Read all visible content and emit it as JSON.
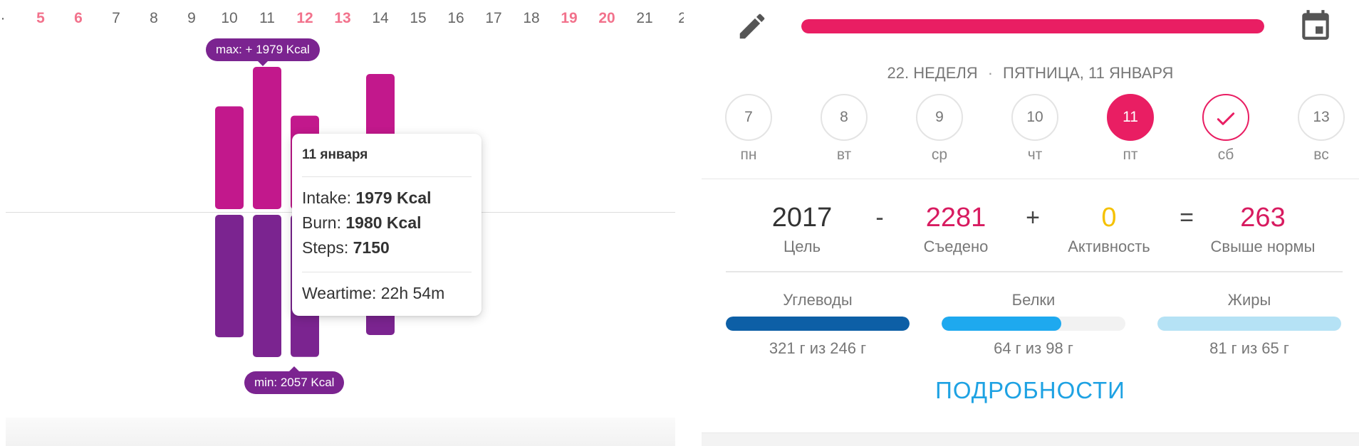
{
  "calendar_strip": {
    "days": [
      {
        "label": "·",
        "weekend": false
      },
      {
        "label": "5",
        "weekend": true
      },
      {
        "label": "6",
        "weekend": true
      },
      {
        "label": "7",
        "weekend": false
      },
      {
        "label": "8",
        "weekend": false
      },
      {
        "label": "9",
        "weekend": false
      },
      {
        "label": "10",
        "weekend": false
      },
      {
        "label": "11",
        "weekend": false
      },
      {
        "label": "12",
        "weekend": true
      },
      {
        "label": "13",
        "weekend": true
      },
      {
        "label": "14",
        "weekend": false
      },
      {
        "label": "15",
        "weekend": false
      },
      {
        "label": "16",
        "weekend": false
      },
      {
        "label": "17",
        "weekend": false
      },
      {
        "label": "18",
        "weekend": false
      },
      {
        "label": "19",
        "weekend": true
      },
      {
        "label": "20",
        "weekend": true
      },
      {
        "label": "21",
        "weekend": false
      },
      {
        "label": "2",
        "weekend": false
      }
    ]
  },
  "chart_data": {
    "type": "bar",
    "categories": [
      "10",
      "11",
      "12",
      "14"
    ],
    "series": [
      {
        "values": [
          1430,
          1979,
          1300,
          1880
        ]
      },
      {
        "values": [
          1770,
          2057,
          2055,
          1738
        ]
      }
    ],
    "max_label": "max: + 1979 Kcal",
    "min_label": "min: 2057 Kcal",
    "colors": {
      "intake": "#c2188c",
      "burn": "#7b2490"
    }
  },
  "tooltip": {
    "date": "11 января",
    "intake_label": "Intake: ",
    "intake_value": "1979 Kcal",
    "burn_label": "Burn: ",
    "burn_value": "1980 Kcal",
    "steps_label": "Steps: ",
    "steps_value": "7150",
    "weartime": "Weartime: 22h 54m"
  },
  "summary": {
    "edit_icon": "pencil-icon",
    "calendar_icon": "calendar-icon",
    "progress": 1.0,
    "progress_color": "#e91e63",
    "week_label": "22. НЕДЕЛЯ",
    "date_label": "ПЯТНИЦА, 11 ЯНВАРЯ",
    "separator": "·",
    "week_days": [
      {
        "num": "7",
        "label": "пн",
        "state": "normal"
      },
      {
        "num": "8",
        "label": "вт",
        "state": "normal"
      },
      {
        "num": "9",
        "label": "ср",
        "state": "normal"
      },
      {
        "num": "10",
        "label": "чт",
        "state": "normal"
      },
      {
        "num": "11",
        "label": "пт",
        "state": "selected"
      },
      {
        "num": "",
        "label": "сб",
        "state": "done"
      },
      {
        "num": "13",
        "label": "вс",
        "state": "normal"
      }
    ],
    "equation": {
      "goal": {
        "value": "2017",
        "label": "Цель",
        "color": "#333333"
      },
      "minus": "-",
      "eaten": {
        "value": "2281",
        "label": "Съедено",
        "color": "#d81b60"
      },
      "plus": "+",
      "activity": {
        "value": "0",
        "label": "Активность",
        "color": "#f5c100"
      },
      "equals": "=",
      "result": {
        "value": "263",
        "label": "Свыше нормы",
        "color": "#d81b60"
      }
    },
    "macros": [
      {
        "name": "Углеводы",
        "amount": "321 г из 246 г",
        "fill": 1.0,
        "color": "#0d5fa6"
      },
      {
        "name": "Белки",
        "amount": "64 г из 98 г",
        "fill": 0.65,
        "color": "#1ea9ef"
      },
      {
        "name": "Жиры",
        "amount": "81 г из 65 г",
        "fill": 1.0,
        "color": "#b5e2f5"
      }
    ],
    "details_label": "ПОДРОБНОСТИ"
  }
}
